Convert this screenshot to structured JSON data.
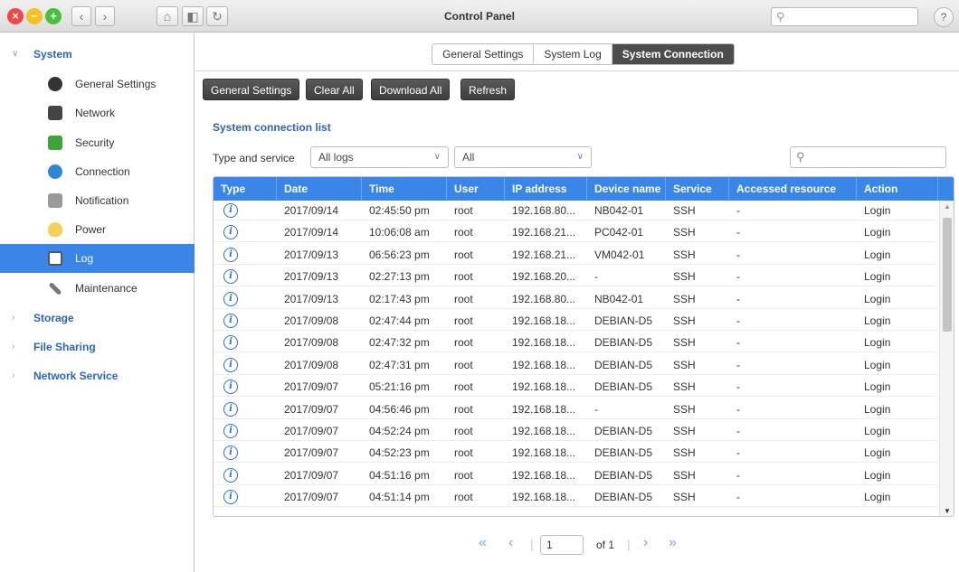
{
  "window": {
    "title": "Control Panel",
    "help_symbol": "?",
    "search_placeholder": ""
  },
  "sidebar": {
    "groups": [
      {
        "label": "System",
        "expanded": true
      },
      {
        "label": "Storage",
        "expanded": false
      },
      {
        "label": "File Sharing",
        "expanded": false
      },
      {
        "label": "Network Service",
        "expanded": false
      }
    ],
    "items": [
      {
        "label": "General Settings",
        "icon": "gear-icon",
        "color": "#333333"
      },
      {
        "label": "Network",
        "icon": "network-icon",
        "color": "#444444"
      },
      {
        "label": "Security",
        "icon": "lock-icon",
        "color": "#3fa33a"
      },
      {
        "label": "Connection",
        "icon": "globe-icon",
        "color": "#2f86d6"
      },
      {
        "label": "Notification",
        "icon": "notification-icon",
        "color": "#9a9a9a"
      },
      {
        "label": "Power",
        "icon": "lightbulb-icon",
        "color": "#f4d25a"
      },
      {
        "label": "Log",
        "icon": "log-icon",
        "color": "#ffffff",
        "active": true
      },
      {
        "label": "Maintenance",
        "icon": "tools-icon",
        "color": "#777777"
      }
    ]
  },
  "tabs": [
    {
      "label": "General Settings",
      "active": false
    },
    {
      "label": "System Log",
      "active": false
    },
    {
      "label": "System Connection",
      "active": true
    }
  ],
  "toolbar": {
    "general_settings": "General Settings",
    "clear_all": "Clear All",
    "download_all": "Download All",
    "refresh": "Refresh"
  },
  "main": {
    "section_title": "System connection list",
    "filter_label": "Type and service",
    "type_filter": "All logs",
    "service_filter": "All",
    "list_search_placeholder": ""
  },
  "table": {
    "columns": [
      "Type",
      "Date",
      "Time",
      "User",
      "IP address",
      "Device name",
      "Service",
      "Accessed resource",
      "Action"
    ],
    "rows": [
      [
        "info",
        "2017/09/14",
        "02:45:50 pm",
        "root",
        "192.168.80...",
        "NB042-01",
        "SSH",
        "-",
        "Login"
      ],
      [
        "info",
        "2017/09/14",
        "10:06:08 am",
        "root",
        "192.168.21...",
        "PC042-01",
        "SSH",
        "-",
        "Login"
      ],
      [
        "info",
        "2017/09/13",
        "06:56:23 pm",
        "root",
        "192.168.21...",
        "VM042-01",
        "SSH",
        "-",
        "Login"
      ],
      [
        "info",
        "2017/09/13",
        "02:27:13 pm",
        "root",
        "192.168.20...",
        "-",
        "SSH",
        "-",
        "Login"
      ],
      [
        "info",
        "2017/09/13",
        "02:17:43 pm",
        "root",
        "192.168.80...",
        "NB042-01",
        "SSH",
        "-",
        "Login"
      ],
      [
        "info",
        "2017/09/08",
        "02:47:44 pm",
        "root",
        "192.168.18...",
        "DEBIAN-D5",
        "SSH",
        "-",
        "Login"
      ],
      [
        "info",
        "2017/09/08",
        "02:47:32 pm",
        "root",
        "192.168.18...",
        "DEBIAN-D5",
        "SSH",
        "-",
        "Login"
      ],
      [
        "info",
        "2017/09/08",
        "02:47:31 pm",
        "root",
        "192.168.18...",
        "DEBIAN-D5",
        "SSH",
        "-",
        "Login"
      ],
      [
        "info",
        "2017/09/07",
        "05:21:16 pm",
        "root",
        "192.168.18...",
        "DEBIAN-D5",
        "SSH",
        "-",
        "Login"
      ],
      [
        "info",
        "2017/09/07",
        "04:56:46 pm",
        "root",
        "192.168.18...",
        "-",
        "SSH",
        "-",
        "Login"
      ],
      [
        "info",
        "2017/09/07",
        "04:52:24 pm",
        "root",
        "192.168.18...",
        "DEBIAN-D5",
        "SSH",
        "-",
        "Login"
      ],
      [
        "info",
        "2017/09/07",
        "04:52:23 pm",
        "root",
        "192.168.18...",
        "DEBIAN-D5",
        "SSH",
        "-",
        "Login"
      ],
      [
        "info",
        "2017/09/07",
        "04:51:16 pm",
        "root",
        "192.168.18...",
        "DEBIAN-D5",
        "SSH",
        "-",
        "Login"
      ],
      [
        "info",
        "2017/09/07",
        "04:51:14 pm",
        "root",
        "192.168.18...",
        "DEBIAN-D5",
        "SSH",
        "-",
        "Login"
      ]
    ]
  },
  "pager": {
    "current_page": "1",
    "of_label": "of 1"
  },
  "colors": {
    "accent": "#3a86e8",
    "link": "#2d63b6"
  }
}
